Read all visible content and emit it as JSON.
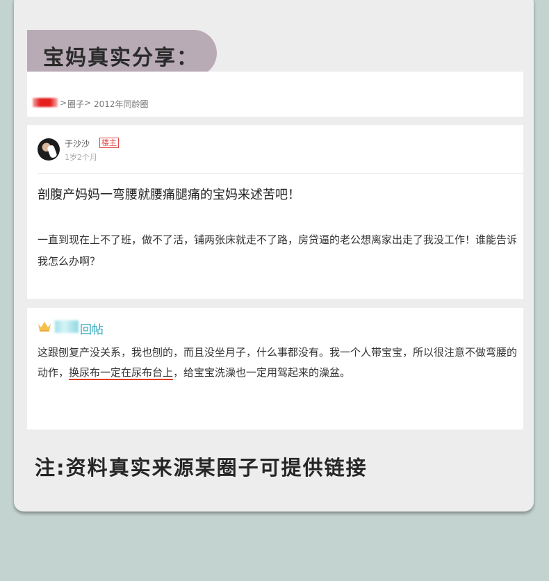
{
  "heading": "宝妈真实分享：",
  "breadcrumb": {
    "sep1": "> ",
    "item1": "圈子",
    "sep2": " > ",
    "item2": "2012年同龄圈"
  },
  "post": {
    "username": "于沙沙",
    "owner_badge": "楼主",
    "child_age": "1岁2个月",
    "title": "剖腹产妈妈一弯腰就腰痛腿痛的宝妈来述苦吧！",
    "body": "一直到现在上不了班，做不了活，铺两张床就走不了路，房贷逼的老公想离家出走了我没工作！谁能告诉我怎么办啊？"
  },
  "reply": {
    "label": "回帖",
    "body_before": "这跟刨复产没关系，我也刨的，而且没坐月子，什么事都没有。我一个人带宝宝，所以很注意不做弯腰的动作，",
    "body_highlight": "换尿布一定在尿布台上",
    "body_after": "，给宝宝洗澡也一定用驾起来的澡盆。"
  },
  "footnote": "注:资料真实来源某圈子可提供链接",
  "colors": {
    "background": "#c3d3cf",
    "card": "#ededed",
    "heading_pill": "#b8abb5",
    "owner_badge": "#e44b4b",
    "reply_label": "#33aabf",
    "highlight_underline": "#e0401f",
    "crown": "#f5c04a"
  },
  "icons": {
    "avatar": "user-avatar",
    "crown": "crown-icon"
  }
}
